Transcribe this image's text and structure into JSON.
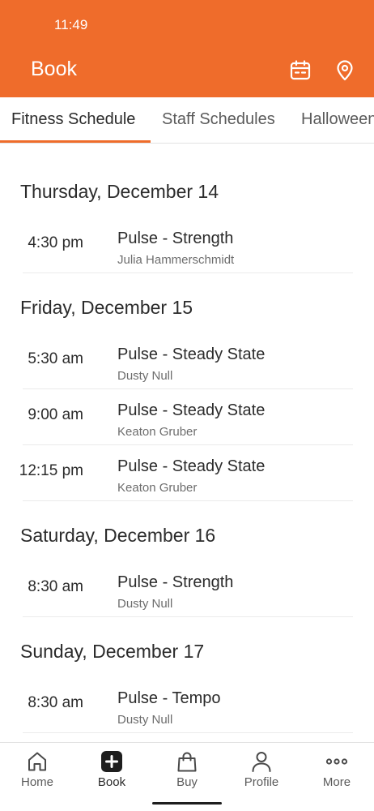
{
  "status_bar": {
    "time": "11:49"
  },
  "header": {
    "title": "Book",
    "icons": [
      "calendar-icon",
      "location-pin-icon"
    ],
    "background_color": "#ef6c2b"
  },
  "tabs": [
    {
      "label": "Fitness Schedule",
      "active": true
    },
    {
      "label": "Staff Schedules",
      "active": false
    },
    {
      "label": "Halloween",
      "active": false
    }
  ],
  "schedule": [
    {
      "day": "Thursday, December 14",
      "classes": [
        {
          "time": "4:30 pm",
          "name": "Pulse - Strength",
          "instructor": "Julia Hammerschmidt"
        }
      ]
    },
    {
      "day": "Friday, December 15",
      "classes": [
        {
          "time": "5:30 am",
          "name": "Pulse - Steady State",
          "instructor": "Dusty Null"
        },
        {
          "time": "9:00 am",
          "name": "Pulse - Steady State",
          "instructor": "Keaton Gruber"
        },
        {
          "time": "12:15 pm",
          "name": "Pulse - Steady State",
          "instructor": "Keaton Gruber"
        }
      ]
    },
    {
      "day": "Saturday, December 16",
      "classes": [
        {
          "time": "8:30 am",
          "name": "Pulse - Strength",
          "instructor": "Dusty Null"
        }
      ]
    },
    {
      "day": "Sunday, December 17",
      "classes": [
        {
          "time": "8:30 am",
          "name": "Pulse - Tempo",
          "instructor": "Dusty Null"
        }
      ]
    }
  ],
  "bottom_nav": [
    {
      "label": "Home",
      "icon": "home-icon",
      "active": false
    },
    {
      "label": "Book",
      "icon": "plus-square-icon",
      "active": true
    },
    {
      "label": "Buy",
      "icon": "shopping-bag-icon",
      "active": false
    },
    {
      "label": "Profile",
      "icon": "person-icon",
      "active": false
    },
    {
      "label": "More",
      "icon": "more-dots-icon",
      "active": false
    }
  ]
}
